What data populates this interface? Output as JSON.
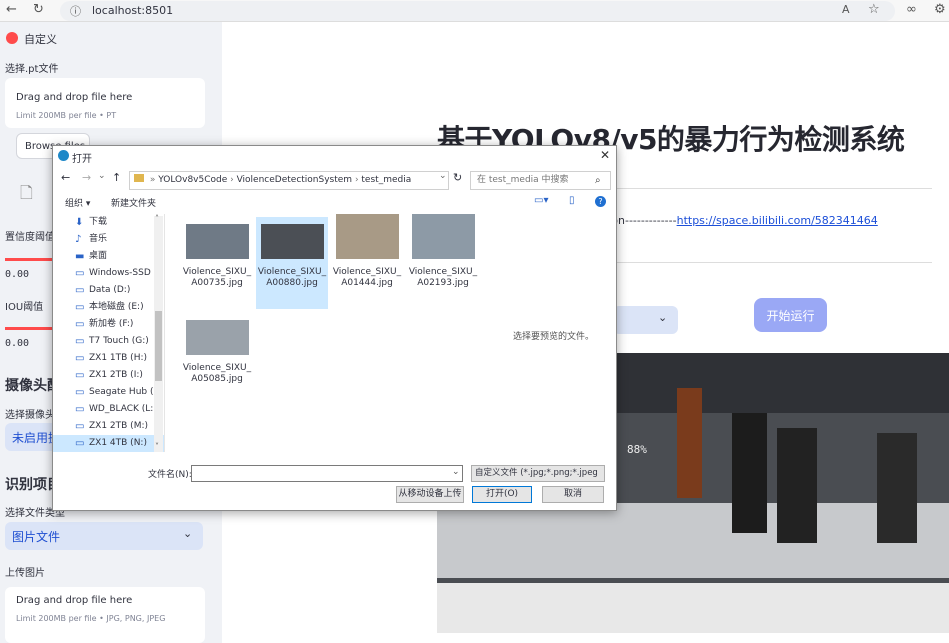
{
  "browser": {
    "url": "localhost:8501"
  },
  "sidebar": {
    "top_label": "自定义",
    "pt_label": "选择.pt文件",
    "drop1_title": "Drag and drop file here",
    "drop1_limit": "Limit 200MB per file • PT",
    "browse_label": "Browse files",
    "conf_label": "置信度阈值",
    "conf_value": "0.00",
    "iou_label": "IOU阈值",
    "iou_value": "0.00",
    "camera_header": "摄像头配置",
    "camera_select_label": "选择摄像头",
    "camera_value": "未启用摄像头",
    "recog_header": "识别项目设置",
    "filetype_label": "选择文件类型",
    "filetype_value": "图片文件",
    "upload_label": "上传图片",
    "drop2_title": "Drag and drop file here",
    "drop2_limit": "Limit 200MB per file • JPG, PNG, JPEG"
  },
  "main": {
    "title": "基于YOLOv8/v5的暴力行为检测系统",
    "link_prefix": "thon-------------",
    "link_text": "https://space.bilibili.com/582341464",
    "run_button": "开始运行",
    "video_overlay": "88%"
  },
  "dialog": {
    "title": "打开",
    "breadcrumb": [
      "YOLOv8v5Code",
      "ViolenceDetectionSystem",
      "test_media"
    ],
    "search_placeholder": "在 test_media 中搜索",
    "organize": "组织",
    "new_folder": "新建文件夹",
    "nav_items": [
      {
        "label": "下载",
        "icon": "download-icon"
      },
      {
        "label": "音乐",
        "icon": "music-icon"
      },
      {
        "label": "桌面",
        "icon": "desktop-icon"
      },
      {
        "label": "Windows-SSD (C:",
        "icon": "drive-icon"
      },
      {
        "label": "Data (D:)",
        "icon": "drive-icon"
      },
      {
        "label": "本地磁盘 (E:)",
        "icon": "drive-icon"
      },
      {
        "label": "新加卷 (F:)",
        "icon": "drive-icon"
      },
      {
        "label": "T7 Touch (G:)",
        "icon": "drive-icon"
      },
      {
        "label": "ZX1 1TB (H:)",
        "icon": "drive-icon"
      },
      {
        "label": "ZX1 2TB (I:)",
        "icon": "drive-icon"
      },
      {
        "label": "Seagate Hub (K:",
        "icon": "drive-icon"
      },
      {
        "label": "WD_BLACK (L:)",
        "icon": "drive-icon"
      },
      {
        "label": "ZX1 2TB (M:)",
        "icon": "drive-icon"
      },
      {
        "label": "ZX1 4TB (N:)",
        "icon": "drive-icon"
      }
    ],
    "files": [
      {
        "name1": "Violence_SIXU_",
        "name2": "A00735.jpg"
      },
      {
        "name1": "Violence_SIXU_",
        "name2": "A00880.jpg"
      },
      {
        "name1": "Violence_SIXU_",
        "name2": "A01444.jpg"
      },
      {
        "name1": "Violence_SIXU_",
        "name2": "A02193.jpg"
      },
      {
        "name1": "Violence_SIXU_",
        "name2": "A05085.jpg"
      }
    ],
    "preview_hint": "选择要预览的文件。",
    "filename_label": "文件名(N):",
    "filetype_filter": "自定义文件 (*.jpg;*.png;*.jpeg",
    "mobile_button": "从移动设备上传",
    "open_button": "打开(O)",
    "cancel_button": "取消"
  }
}
